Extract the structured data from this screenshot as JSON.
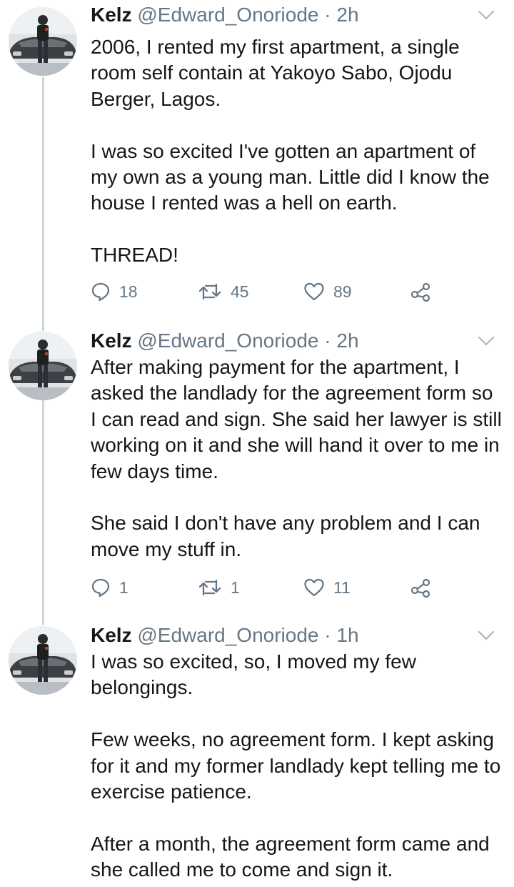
{
  "colors": {
    "text": "#14171a",
    "secondary": "#657786",
    "thread_line": "#ccd6dd"
  },
  "tweets": [
    {
      "name": "Kelz",
      "handle": "@Edward_Onoriode",
      "separator": "·",
      "time": "2h",
      "paragraphs": [
        "2006, I rented my first apartment, a single room self contain at Yakoyo Sabo, Ojodu Berger, Lagos.",
        "I was so excited I've gotten an apartment of my own as a young man. Little did I know the house I rented was a hell on earth.",
        "THREAD!"
      ],
      "replies": "18",
      "retweets": "45",
      "likes": "89"
    },
    {
      "name": "Kelz",
      "handle": "@Edward_Onoriode",
      "separator": "·",
      "time": "2h",
      "paragraphs": [
        "After making payment for the apartment, I asked the landlady for the agreement form so I can read and sign. She said her lawyer is still working on it and she will hand it over to me in few days time.",
        "She said I don't have any problem and I can move my stuff in."
      ],
      "replies": "1",
      "retweets": "1",
      "likes": "11"
    },
    {
      "name": "Kelz",
      "handle": "@Edward_Onoriode",
      "separator": "·",
      "time": "1h",
      "paragraphs": [
        "I was so excited, so, I moved my few belongings.",
        "Few weeks, no agreement form. I kept asking for it and my former landlady kept telling me to exercise patience.",
        "After a month, the agreement form came and she called me to come and sign it."
      ]
    }
  ]
}
